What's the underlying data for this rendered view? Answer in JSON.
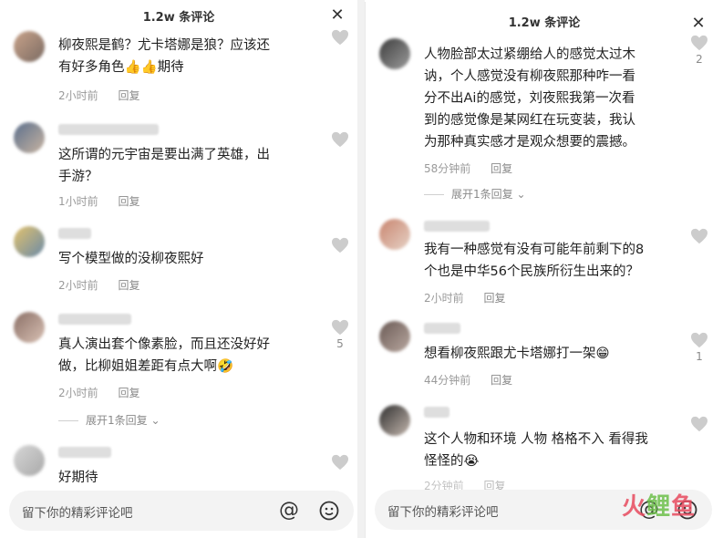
{
  "left": {
    "title": "1.2w 条评论",
    "comments": [
      {
        "lines": [
          "柳夜熙是鹤？尤卡塔娜是狼？应该还",
          "有好多角色👍👍期待"
        ],
        "time": "2小时前",
        "reply": "回复",
        "likes": ""
      },
      {
        "lines": [
          "这所谓的元宇宙是要出满了英雄，出",
          "手游？"
        ],
        "time": "1小时前",
        "reply": "回复",
        "likes": ""
      },
      {
        "lines": [
          "写个模型做的没柳夜熙好"
        ],
        "time": "2小时前",
        "reply": "回复",
        "likes": ""
      },
      {
        "lines": [
          "真人演出套个像素脸，而且还没好好",
          "做，比柳姐姐差距有点大啊🤣"
        ],
        "time": "2小时前",
        "reply": "回复",
        "likes": "5",
        "expand": "展开1条回复"
      },
      {
        "lines": [
          "好期待"
        ],
        "time": "",
        "reply": "",
        "likes": ""
      }
    ],
    "input_placeholder": "留下你的精彩评论吧"
  },
  "right": {
    "title": "1.2w 条评论",
    "comments": [
      {
        "lines": [
          "人物脸部太过紧绷给人的感觉太过木",
          "讷，个人感觉没有柳夜熙那种咋一看",
          "分不出Ai的感觉，刘夜熙我第一次看",
          "到的感觉像是某网红在玩变装，我认",
          "为那种真实感才是观众想要的震撼。"
        ],
        "time": "58分钟前",
        "reply": "回复",
        "likes": "2",
        "expand": "展开1条回复"
      },
      {
        "lines": [
          "我有一种感觉有没有可能年前剩下的8",
          "个也是中华56个民族所衍生出来的？"
        ],
        "time": "2小时前",
        "reply": "回复",
        "likes": ""
      },
      {
        "lines": [
          "想看柳夜熙跟尤卡塔娜打一架😁"
        ],
        "time": "44分钟前",
        "reply": "回复",
        "likes": "1"
      },
      {
        "lines": [
          "这个人物和环境 人物 格格不入 看得我",
          "怪怪的😭"
        ],
        "time": "2分钟前",
        "reply": "回复",
        "likes": ""
      }
    ],
    "input_placeholder": "留下你的精彩评论吧"
  },
  "icons": {
    "close": "close-icon",
    "like": "heart-icon",
    "at": "at-icon",
    "emoji": "smiley-icon"
  },
  "watermark": {
    "part1": "火",
    "part2": "鲤",
    "part3": "鱼"
  },
  "colors": {
    "text": "#222222",
    "meta": "#9a9a9a",
    "heart": "#cccccc",
    "input_bg": "#f3f3f3",
    "watermark": "#e84a5f"
  }
}
